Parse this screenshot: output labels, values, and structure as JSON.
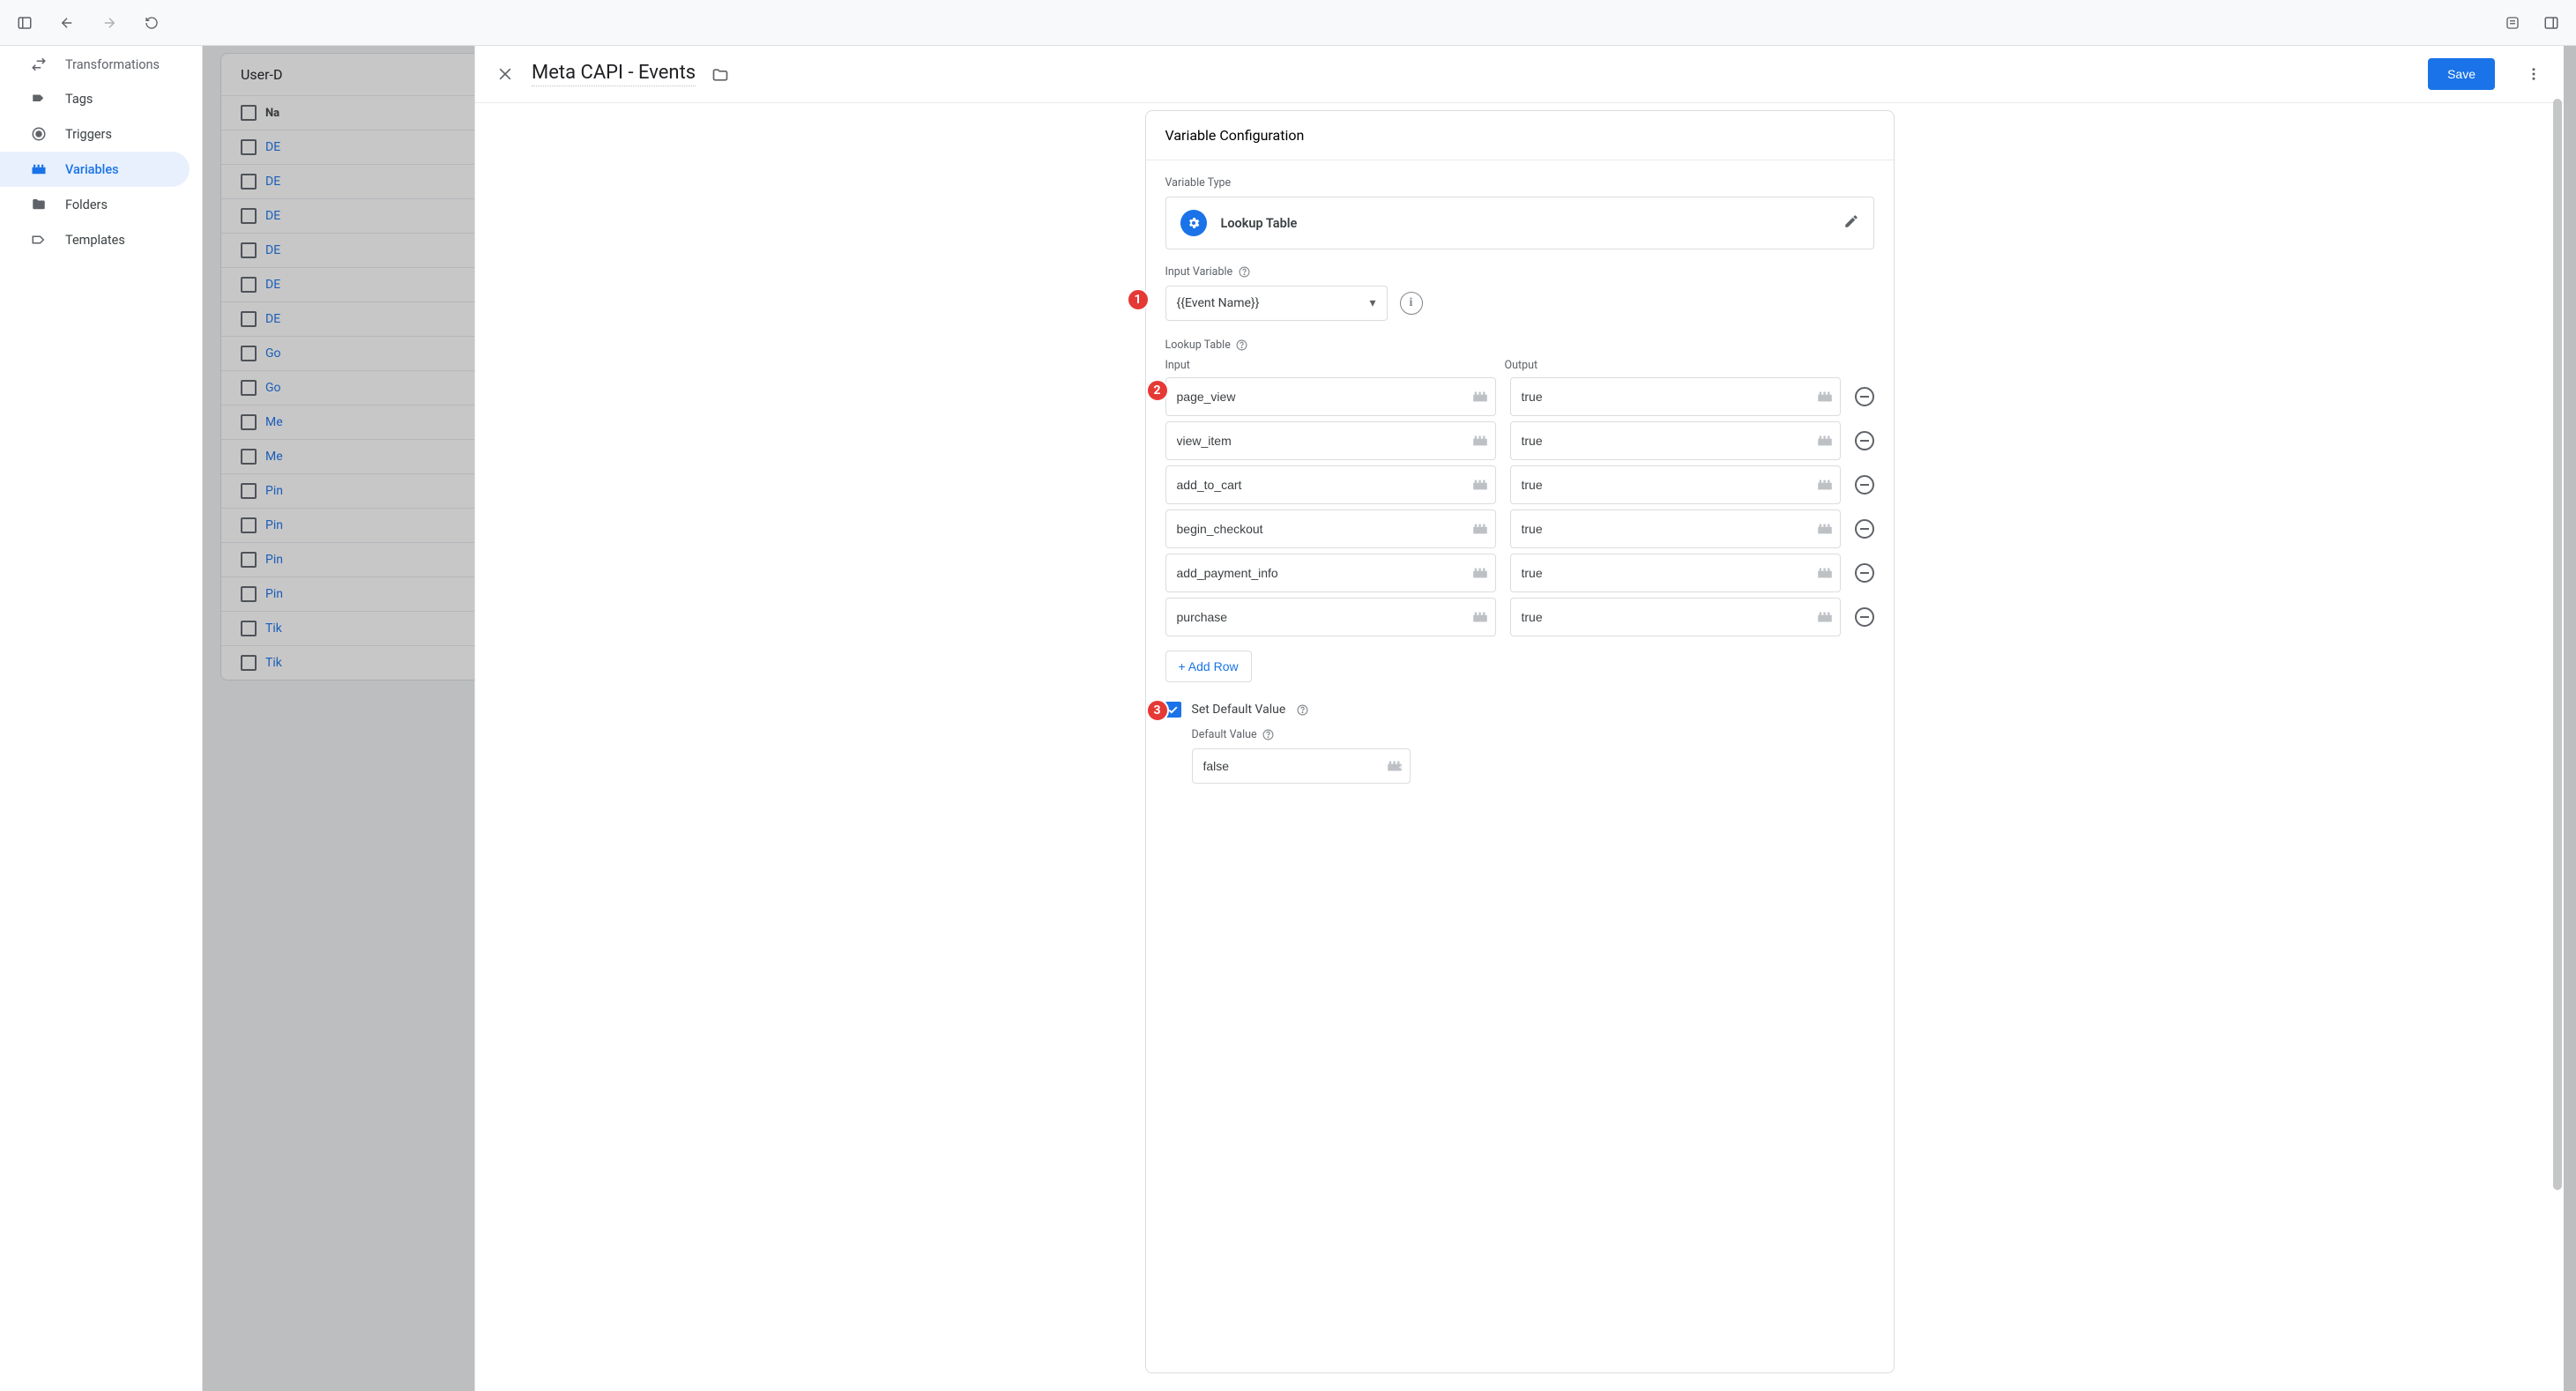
{
  "chrome": {},
  "sidebar": {
    "items": [
      {
        "label": "Transformations"
      },
      {
        "label": "Tags"
      },
      {
        "label": "Triggers"
      },
      {
        "label": "Variables"
      },
      {
        "label": "Folders"
      },
      {
        "label": "Templates"
      }
    ]
  },
  "list": {
    "title": "User-D",
    "name_header": "Na",
    "rows": [
      "DE",
      "DE",
      "DE",
      "DE",
      "DE",
      "DE",
      "Go",
      "Go",
      "Me",
      "Me",
      "Pin",
      "Pin",
      "Pin",
      "Pin",
      "Tik",
      "Tik"
    ]
  },
  "panel": {
    "title": "Meta CAPI - Events",
    "save_label": "Save",
    "config_title": "Variable Configuration",
    "variable_type_label": "Variable Type",
    "variable_type_name": "Lookup Table",
    "input_variable_label": "Input Variable",
    "input_variable_value": "{{Event Name}}",
    "lookup_table_label": "Lookup Table",
    "input_col": "Input",
    "output_col": "Output",
    "rows": [
      {
        "input": "page_view",
        "output": "true"
      },
      {
        "input": "view_item",
        "output": "true"
      },
      {
        "input": "add_to_cart",
        "output": "true"
      },
      {
        "input": "begin_checkout",
        "output": "true"
      },
      {
        "input": "add_payment_info",
        "output": "true"
      },
      {
        "input": "purchase",
        "output": "true"
      }
    ],
    "add_row_label": "+ Add Row",
    "set_default_label": "Set Default Value",
    "default_value_label": "Default Value",
    "default_value": "false"
  },
  "annotations": {
    "a1": "1",
    "a2": "2",
    "a3": "3"
  }
}
